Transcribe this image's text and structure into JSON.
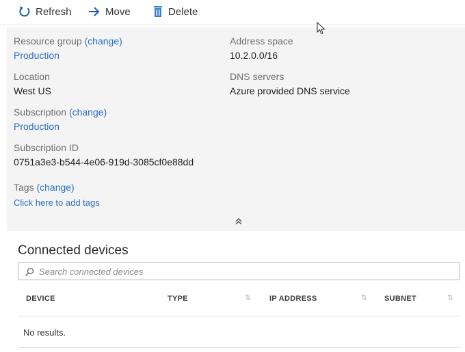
{
  "toolbar": {
    "refresh_label": "Refresh",
    "move_label": "Move",
    "delete_label": "Delete"
  },
  "essentials": {
    "resource_group_label": "Resource group",
    "resource_group_change": "(change)",
    "resource_group_value": "Production",
    "location_label": "Location",
    "location_value": "West US",
    "subscription_label": "Subscription",
    "subscription_change": "(change)",
    "subscription_value": "Production",
    "subscription_id_label": "Subscription ID",
    "subscription_id_value": "0751a3e3-b544-4e06-919d-3085cf0e88dd",
    "tags_label": "Tags",
    "tags_change": "(change)",
    "tags_add": "Click here to add tags",
    "address_space_label": "Address space",
    "address_space_value": "10.2.0.0/16",
    "dns_servers_label": "DNS servers",
    "dns_servers_value": "Azure provided DNS service"
  },
  "connected_devices": {
    "title": "Connected devices",
    "search_placeholder": "Search connected devices",
    "columns": [
      "DEVICE",
      "TYPE",
      "IP ADDRESS",
      "SUBNET"
    ],
    "empty_text": "No results."
  },
  "colors": {
    "link": "#2a6fc2",
    "essentials_bg": "#f4f4f4",
    "icon_blue": "#1a5ea8"
  },
  "icons": {
    "refresh": "refresh-icon",
    "move": "arrow-right-icon",
    "delete": "trash-icon",
    "collapse": "double-chevron-up-icon",
    "search": "search-icon",
    "cursor": "mouse-cursor-icon"
  }
}
